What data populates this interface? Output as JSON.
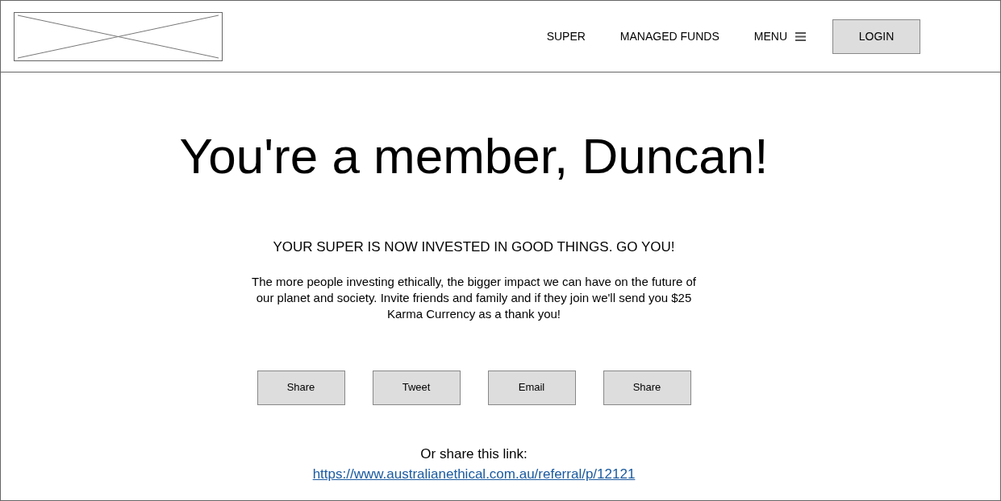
{
  "nav": {
    "items": [
      {
        "label": "SUPER"
      },
      {
        "label": "MANAGED FUNDS"
      },
      {
        "label": "MENU",
        "kind": "menu"
      }
    ],
    "login": "LOGIN"
  },
  "heading": "You're a member, Duncan!",
  "subheading": "YOUR SUPER IS NOW INVESTED IN GOOD THINGS. GO YOU!",
  "body": "The more people investing ethically, the bigger impact we can have on the future of our planet and society. Invite friends and family and if they join we'll send you $25 Karma Currency as a thank you!",
  "share_buttons": [
    "Share",
    "Tweet",
    "Email",
    "Share"
  ],
  "link_label": "Or share this link:",
  "link": "https://www.australianethical.com.au/referral/p/12121"
}
